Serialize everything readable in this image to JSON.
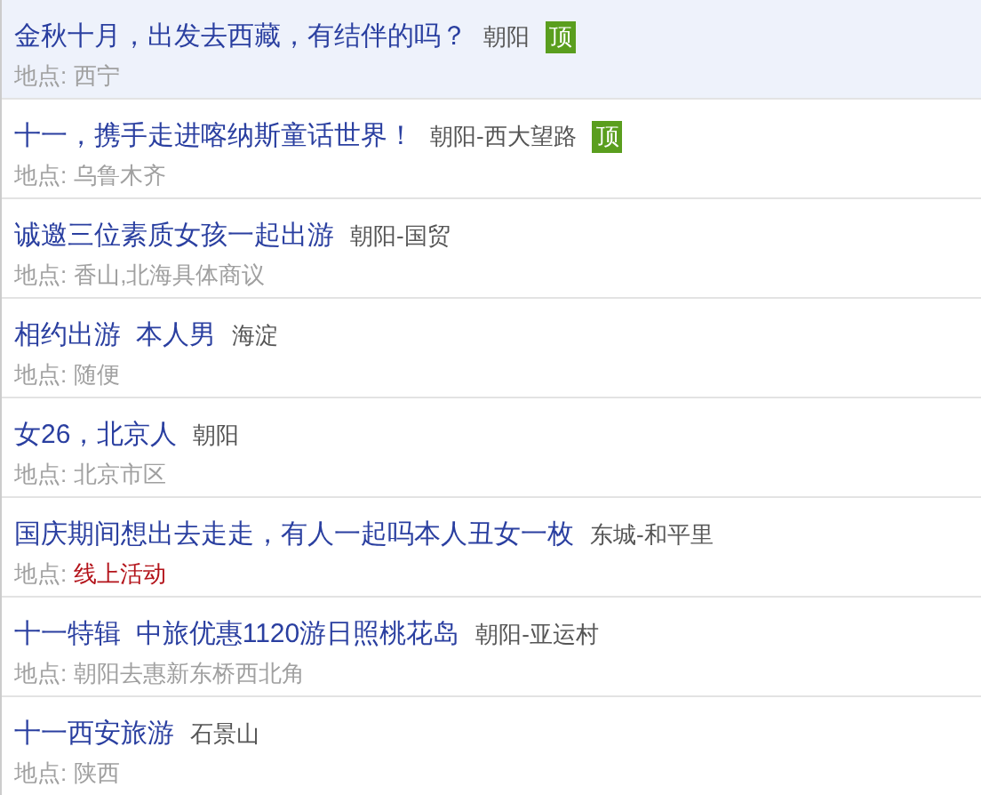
{
  "listings": [
    {
      "title": "金秋十月，出发去西藏，有结伴的吗？",
      "district": "朝阳",
      "badge": "顶",
      "place_label": "地点:",
      "place": "西宁",
      "place_highlighted": false,
      "selected": true
    },
    {
      "title": "十一，携手走进喀纳斯童话世界！",
      "district": "朝阳-西大望路",
      "badge": "顶",
      "place_label": "地点:",
      "place": "乌鲁木齐",
      "place_highlighted": false,
      "selected": false
    },
    {
      "title": "诚邀三位素质女孩一起出游",
      "district": "朝阳-国贸",
      "place_label": "地点:",
      "place": "香山,北海具体商议",
      "place_highlighted": false,
      "selected": false
    },
    {
      "title": "相约出游  本人男",
      "district": "海淀",
      "place_label": "地点:",
      "place": "随便",
      "place_highlighted": false,
      "selected": false
    },
    {
      "title": "女26，北京人",
      "district": "朝阳",
      "place_label": "地点:",
      "place": "北京市区",
      "place_highlighted": false,
      "selected": false
    },
    {
      "title": "国庆期间想出去走走，有人一起吗本人丑女一枚",
      "district": "东城-和平里",
      "place_label": "地点:",
      "place": "线上活动",
      "place_highlighted": true,
      "selected": false
    },
    {
      "title": "十一特辑  中旅优惠1120游日照桃花岛",
      "district": "朝阳-亚运村",
      "place_label": "地点:",
      "place": "朝阳去惠新东桥西北角",
      "place_highlighted": false,
      "selected": false
    },
    {
      "title": "十一西安旅游",
      "district": "石景山",
      "place_label": "地点:",
      "place": "陕西",
      "place_highlighted": false,
      "selected": false
    }
  ]
}
